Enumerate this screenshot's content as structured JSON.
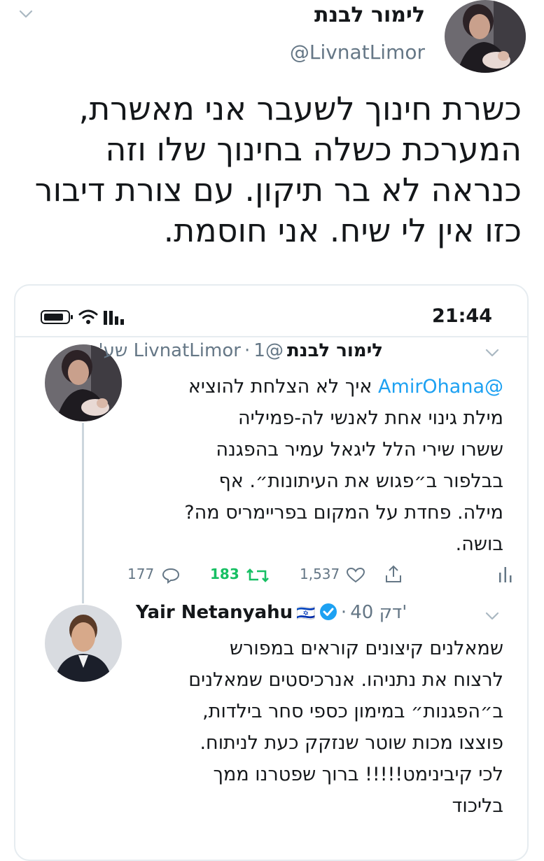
{
  "main_tweet": {
    "author_name": "לימור לבנת",
    "handle": "@LivnatLimor",
    "text_lines": [
      "כשרת חינוך לשעבר אני מאשרת,",
      "המערכת כשלה בחינוך שלו וזה",
      "כנראה לא בר תיקון. עם צורת דיבור",
      "כזו אין לי שיח. אני חוסמת."
    ]
  },
  "status_bar": {
    "time": "21:44"
  },
  "tweet1": {
    "author_name": "לימור לבנת",
    "handle": "@LivnatLimor",
    "time_ago": "1 שע'",
    "mention": "@AmirOhana",
    "first_line_rest": "איך לא הצלחת להוציא",
    "text_lines": [
      "מילת גינוי אחת לאנשי לה-פמיליה",
      "ששרו שירי הלל ליגאל עמיר בהפגנה",
      "בבלפור ב״פגוש את העיתונות״. אף",
      "מילה. פחדת על המקום בפריימריס מה?",
      "בושה."
    ],
    "replies": "177",
    "retweets": "183",
    "likes": "1,537"
  },
  "tweet2": {
    "author_name": "Yair Netanyahu",
    "flag": "🇮🇱",
    "time_ago": "40 דק'",
    "text_lines": [
      "שמאלנים קיצונים קוראים במפורש",
      "לרצוח את נתניהו. אנרכיסטים שמאלנים",
      "ב״הפגנות״ במימון כספי סחר בילדות,",
      "פוצצו מכות שוטר שנזקק כעת לניתוח.",
      "לכי קיבינימט!!!!! ברוך שפטרנו ממך",
      "בליכוד"
    ]
  },
  "colors": {
    "text": "#14171a",
    "secondary": "#657786",
    "link": "#1da1f2",
    "retweet_active": "#17bf63",
    "border": "#e6ecf0"
  }
}
